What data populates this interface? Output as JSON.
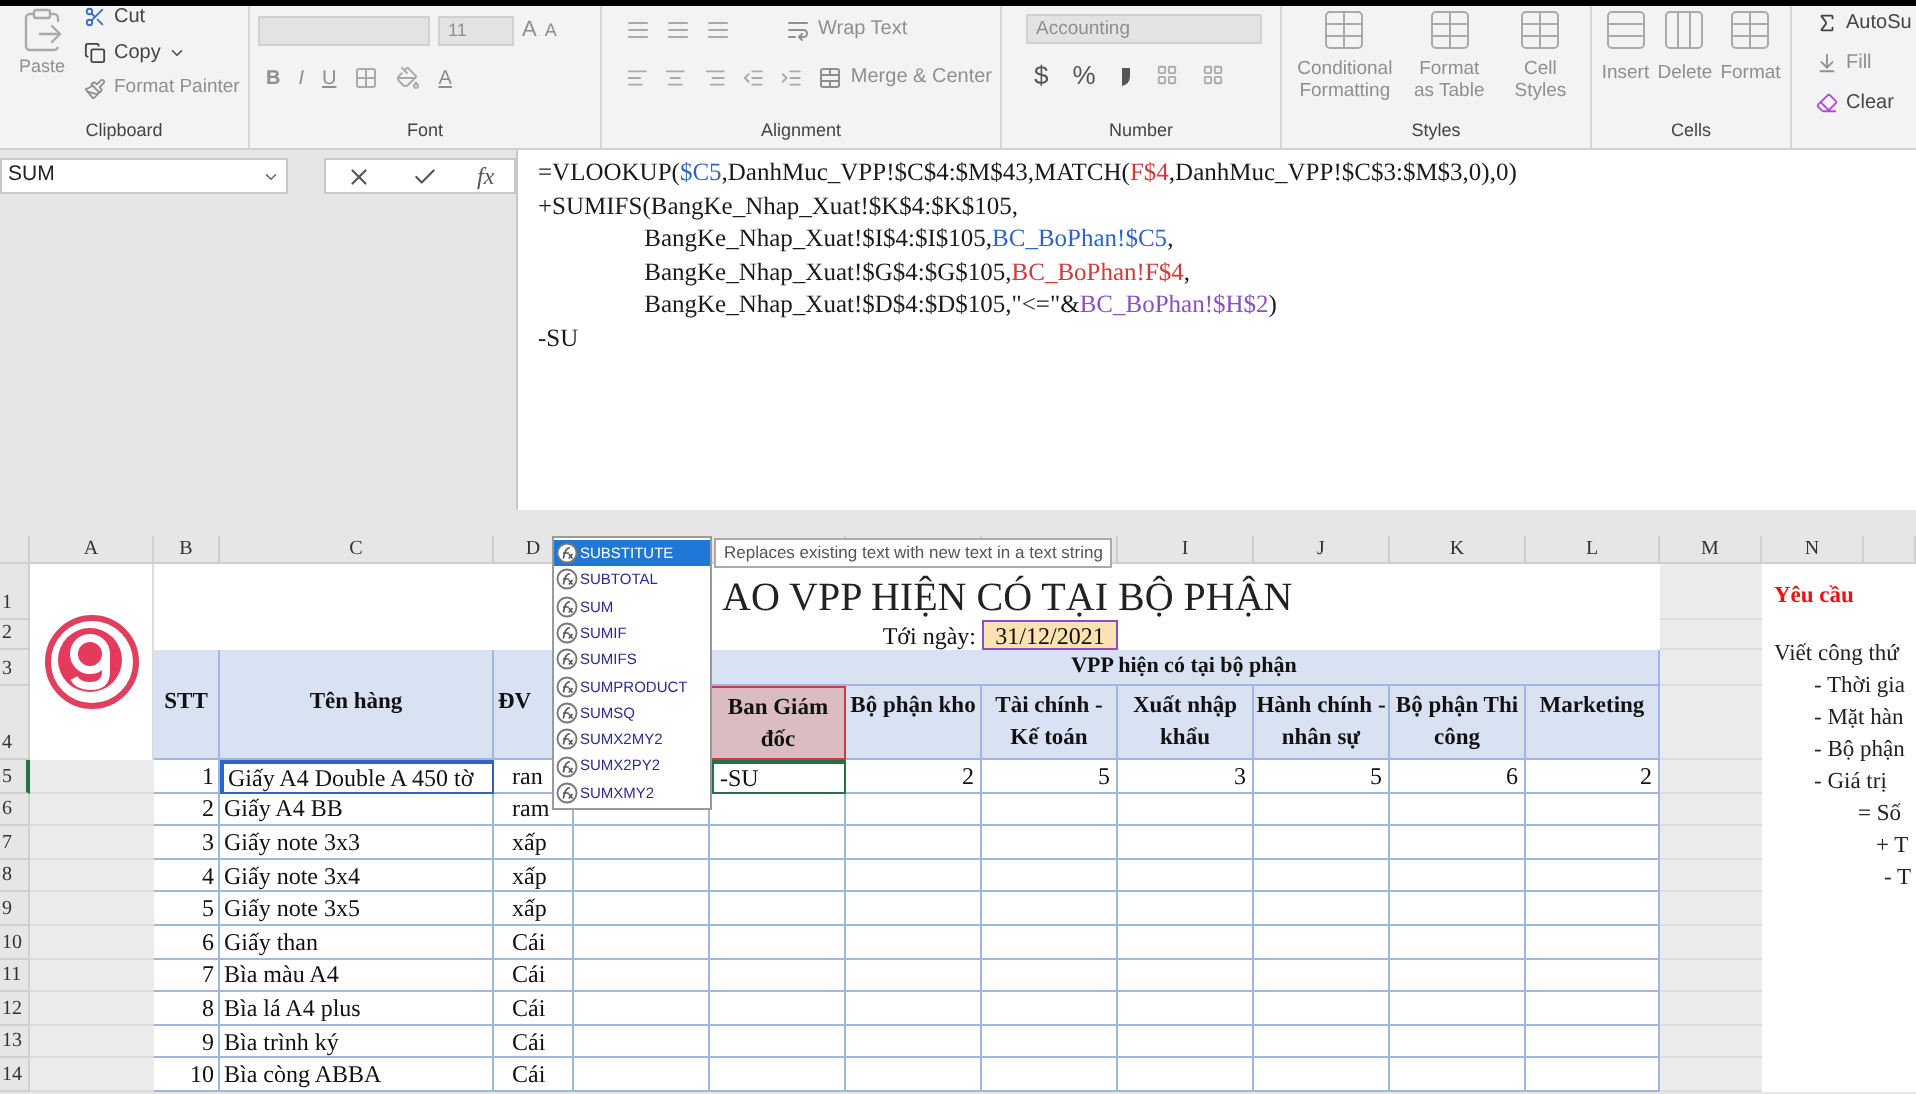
{
  "ribbon": {
    "clipboard": {
      "label": "Clipboard",
      "paste": "Paste",
      "cut": "Cut",
      "copy": "Copy",
      "format_painter": "Format Painter"
    },
    "font": {
      "label": "Font",
      "size": "11",
      "grow": "A",
      "shrink": "A",
      "bold": "B",
      "italic": "I",
      "underline": "U",
      "font_color": "A"
    },
    "alignment": {
      "label": "Alignment",
      "wrap_text": "Wrap Text",
      "merge_center": "Merge & Center"
    },
    "number": {
      "label": "Number",
      "format": "Accounting",
      "currency": "$",
      "percent": "%"
    },
    "styles": {
      "label": "Styles",
      "conditional_formatting": "Conditional Formatting",
      "format_as_table": "Format as Table",
      "cell_styles": "Cell Styles"
    },
    "cells": {
      "label": "Cells",
      "insert": "Insert",
      "delete": "Delete",
      "format": "Format"
    },
    "editing": {
      "autosum": "AutoSu",
      "fill": "Fill",
      "clear": "Clear"
    }
  },
  "formula_bar": {
    "name_box": "SUM",
    "fx": "fx",
    "lines": [
      {
        "parts": [
          {
            "text": "=VLOOKUP(",
            "color": "#1a1a1a"
          },
          {
            "text": "$C5",
            "color": "#2e64c8"
          },
          {
            "text": ",DanhMuc_VPP!$C$4:$M$43,MATCH(",
            "color": "#1a1a1a"
          },
          {
            "text": "F$4",
            "color": "#d03a3a"
          },
          {
            "text": ",DanhMuc_VPP!$C$3:$M$3,0),0)",
            "color": "#1a1a1a"
          }
        ]
      },
      {
        "parts": [
          {
            "text": "+SUMIFS(BangKe_Nhap_Xuat!$K$4:$K$105,",
            "color": "#1a1a1a"
          }
        ]
      },
      {
        "parts": [
          {
            "text": "                 BangKe_Nhap_Xuat!$I$4:$I$105,",
            "color": "#1a1a1a"
          },
          {
            "text": "BC_BoPhan!$C5",
            "color": "#2e64c8"
          },
          {
            "text": ",",
            "color": "#1a1a1a"
          }
        ]
      },
      {
        "parts": [
          {
            "text": "                 BangKe_Nhap_Xuat!$G$4:$G$105,",
            "color": "#1a1a1a"
          },
          {
            "text": "BC_BoPhan!F$4",
            "color": "#d03a3a"
          },
          {
            "text": ",",
            "color": "#1a1a1a"
          }
        ]
      },
      {
        "parts": [
          {
            "text": "                 BangKe_Nhap_Xuat!$D$4:$D$105,\"<=\"&",
            "color": "#1a1a1a"
          },
          {
            "text": "BC_BoPhan!$H$2",
            "color": "#8a4fc4"
          },
          {
            "text": ")",
            "color": "#1a1a1a"
          }
        ]
      },
      {
        "parts": [
          {
            "text": "-SU",
            "color": "#1a1a1a"
          }
        ]
      }
    ]
  },
  "column_headers": [
    "A",
    "B",
    "C",
    "D",
    "I",
    "J",
    "K",
    "L",
    "M",
    "N"
  ],
  "row_headers": [
    "1",
    "2",
    "3",
    "4"
  ],
  "sheet": {
    "title": "AO VPP HIỆN CÓ TẠI BỘ PHẬN",
    "date_label": "Tới ngày:",
    "date": {
      "text": "31/12/2021",
      "color": "#8a4fc4"
    },
    "headers": {
      "stt": "STT",
      "name": "Tên hàng",
      "unit": "ĐV",
      "group": "VPP hiện có tại bộ phận",
      "departments": [
        {
          "label": "Ban Giám đốc",
          "color": "#d03a3a"
        },
        {
          "label": "Bộ phận kho"
        },
        {
          "label": "Tài chính - Kế toán"
        },
        {
          "label": "Xuất nhập khẩu"
        },
        {
          "label": "Hành chính - nhân sự"
        },
        {
          "label": "Bộ phận Thi công"
        },
        {
          "label": "Marketing"
        }
      ]
    },
    "rows": [
      {
        "number": "5",
        "stt": "1",
        "name": "Giấy A4 Double A 450 tờ",
        "color": "#2e64c8",
        "unit": "ran",
        "values": [
          {
            "text": "-SU",
            "selected": true
          },
          {
            "text": "2",
            "selected": false
          },
          {
            "text": "5",
            "selected": false
          },
          {
            "text": "3",
            "selected": false
          },
          {
            "text": "5",
            "selected": false
          },
          {
            "text": "6",
            "selected": false
          },
          {
            "text": "2",
            "selected": false
          }
        ]
      },
      {
        "number": "6",
        "stt": "2",
        "name": "Giấy A4 BB",
        "unit": "ram"
      },
      {
        "number": "7",
        "stt": "3",
        "name": "Giấy note 3x3",
        "unit": "xấp"
      },
      {
        "number": "8",
        "stt": "4",
        "name": "Giấy note 3x4",
        "unit": "xấp"
      },
      {
        "number": "9",
        "stt": "5",
        "name": "Giấy note 3x5",
        "unit": "xấp"
      },
      {
        "number": "10",
        "stt": "6",
        "name": "Giấy than",
        "unit": "Cái"
      },
      {
        "number": "11",
        "stt": "7",
        "name": "Bìa màu A4",
        "unit": "Cái"
      },
      {
        "number": "12",
        "stt": "8",
        "name": "Bìa lá A4 plus",
        "unit": "Cái"
      },
      {
        "number": "13",
        "stt": "9",
        "name": "Bìa trình ký",
        "unit": "Cái"
      },
      {
        "number": "14",
        "stt": "10",
        "name": "Bìa còng ABBA",
        "unit": "Cái"
      }
    ]
  },
  "notes": {
    "title": "Yêu cầu",
    "lines": [
      {
        "kind": "intro",
        "text": "Viết công thứ"
      },
      {
        "kind": "bullet",
        "text": "- Thời gia"
      },
      {
        "kind": "bullet",
        "text": "- Mặt hàn"
      },
      {
        "kind": "bullet",
        "text": "- Bộ phận"
      },
      {
        "kind": "bullet",
        "text": "- Giá trị"
      },
      {
        "kind": "sum",
        "text": "= Số"
      },
      {
        "kind": "plus",
        "text": "+ T"
      },
      {
        "kind": "minus",
        "text": "- T"
      }
    ]
  },
  "autocomplete": {
    "items": [
      {
        "label": "SUBSTITUTE",
        "selected": true
      },
      {
        "label": "SUBTOTAL",
        "selected": false
      },
      {
        "label": "SUM",
        "selected": false
      },
      {
        "label": "SUMIF",
        "selected": false
      },
      {
        "label": "SUMIFS",
        "selected": false
      },
      {
        "label": "SUMPRODUCT",
        "selected": false
      },
      {
        "label": "SUMSQ",
        "selected": false
      },
      {
        "label": "SUMX2MY2",
        "selected": false
      },
      {
        "label": "SUMX2PY2",
        "selected": false
      },
      {
        "label": "SUMXMY2",
        "selected": false
      }
    ],
    "tooltip": "Replaces existing text with new text in a text string"
  }
}
